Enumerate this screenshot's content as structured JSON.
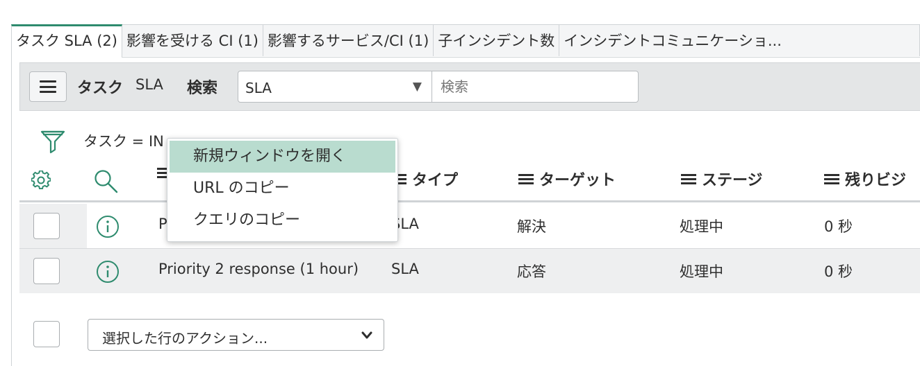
{
  "tabs": [
    {
      "label": "タスク SLA (2)"
    },
    {
      "label": "影響を受ける CI (1)"
    },
    {
      "label": "影響するサービス/CI (1)"
    },
    {
      "label": "子インシデント数"
    },
    {
      "label": "インシデントコミュニケーショ..."
    }
  ],
  "toolbar": {
    "title": "タスク",
    "title_suffix": "SLA",
    "search_label": "検索",
    "search_field_value": "SLA",
    "search_placeholder": "検索"
  },
  "filter": {
    "text_visible": "タスク = IN"
  },
  "columns": [
    {
      "label": "タイプ"
    },
    {
      "label": "ターゲット"
    },
    {
      "label": "ステージ"
    },
    {
      "label": "残りビジ"
    }
  ],
  "rows": [
    {
      "definition": "P",
      "type": "SLA",
      "target": "解決",
      "stage": "処理中",
      "remaining": "0 秒"
    },
    {
      "definition": "Priority 2 response (1 hour)",
      "type": "SLA",
      "target": "応答",
      "stage": "処理中",
      "remaining": "0 秒"
    }
  ],
  "actions": {
    "select_label": "選択した行のアクション..."
  },
  "context_menu": {
    "items": [
      {
        "label": "新規ウィンドウを開く"
      },
      {
        "label": "URL のコピー"
      },
      {
        "label": "クエリのコピー"
      }
    ]
  },
  "colors": {
    "accent": "#2e8b6e",
    "menu_hover": "#b9dccf",
    "toolbar_bg": "#e4e6e7",
    "alt_row_bg": "#eeeff0"
  }
}
